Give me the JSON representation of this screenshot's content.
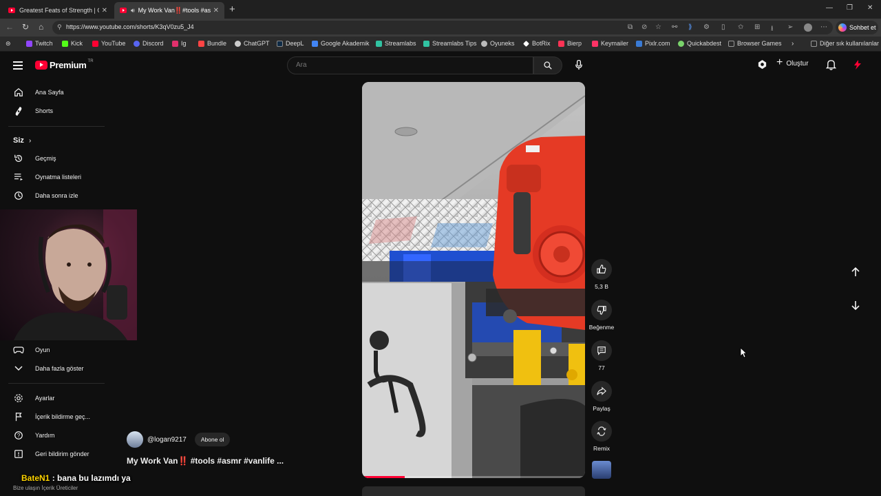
{
  "browser": {
    "tabs": [
      {
        "title": "Greatest Feats of Strength | Giants",
        "active": false
      },
      {
        "title": "My Work Van‼️#tools #asmr #",
        "active": true
      }
    ],
    "url": "https://www.youtube.com/shorts/K3qV0zu5_J4",
    "copilot_label": "Sohbet et",
    "bookmarks": [
      {
        "label": "Twitch",
        "color": "#9146ff"
      },
      {
        "label": "Kick",
        "color": "#53fc18"
      },
      {
        "label": "YouTube",
        "color": "#ff0033"
      },
      {
        "label": "Discord",
        "color": "#5865f2"
      },
      {
        "label": "Ig",
        "color": "#e1306c"
      },
      {
        "label": "Bundle",
        "color": "#ff4444"
      },
      {
        "label": "ChatGPT",
        "color": "#cccccc"
      },
      {
        "label": "DeepL",
        "color": "#0f2b46"
      },
      {
        "label": "Google Akademik",
        "color": "#4285f4"
      },
      {
        "label": "Streamlabs",
        "color": "#31c3a2"
      },
      {
        "label": "Streamlabs Tips",
        "color": "#31c3a2"
      },
      {
        "label": "Oyuneks",
        "color": "#bbbbbb"
      },
      {
        "label": "BotRix",
        "color": "#ffffff"
      },
      {
        "label": "Bierp",
        "color": "#ff3355"
      },
      {
        "label": "Keymailer",
        "color": "#ff3366"
      },
      {
        "label": "Pixlr.com",
        "color": "#3a7bd5"
      },
      {
        "label": "Quickabdest",
        "color": "#7ad36b"
      },
      {
        "label": "Browser Games",
        "color": "#999999"
      }
    ],
    "other_bookmarks": "Diğer sık kullanılanlar"
  },
  "youtube": {
    "logo_text": "Premium",
    "logo_cc": "TR",
    "search_placeholder": "Ara",
    "create_label": "Oluştur"
  },
  "sidebar": {
    "top": [
      {
        "label": "Ana Sayfa",
        "icon": "home-icon"
      },
      {
        "label": "Shorts",
        "icon": "shorts-icon"
      }
    ],
    "you_section": "Siz",
    "you_items": [
      {
        "label": "Geçmiş",
        "icon": "history-icon"
      },
      {
        "label": "Oynatma listeleri",
        "icon": "playlist-icon"
      },
      {
        "label": "Daha sonra izle",
        "icon": "clock-icon"
      }
    ],
    "explore_items": [
      {
        "label": "Oyun",
        "icon": "gaming-icon"
      },
      {
        "label": "Daha fazla göster",
        "icon": "chevron-down-icon"
      }
    ],
    "settings_items": [
      {
        "label": "Ayarlar",
        "icon": "gear-icon"
      },
      {
        "label": "İçerik bildirme geç...",
        "icon": "flag-icon"
      },
      {
        "label": "Yardım",
        "icon": "help-icon"
      },
      {
        "label": "Geri bildirim gönder",
        "icon": "feedback-icon"
      }
    ],
    "footer": "Bize ulaşın   İçerik Üreticiler"
  },
  "short": {
    "channel": "@logan9217",
    "subscribe": "Abone ol",
    "title": "My Work Van‼️ #tools #asmr #vanlife ...",
    "progress": 0.19,
    "actions": {
      "likes": "5,3 B",
      "dislike": "Beğenme",
      "comments": "77",
      "share": "Paylaş",
      "remix": "Remix"
    }
  },
  "chat_overlay": {
    "user": "BateN1",
    "message": " : bana bu lazımdı ya"
  },
  "colors": {
    "accent": "#ff0033",
    "background": "#0f0f0f"
  }
}
